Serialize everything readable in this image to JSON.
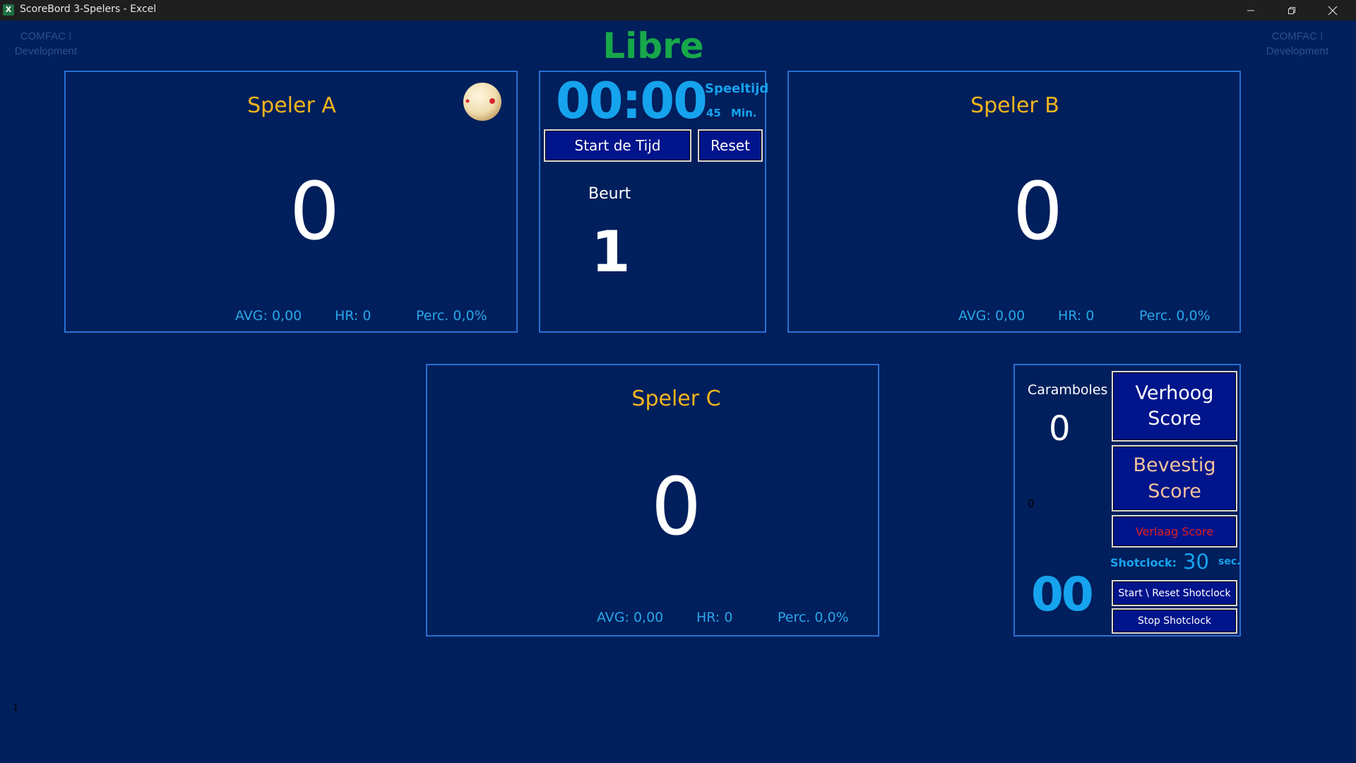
{
  "window": {
    "title": "ScoreBord 3-Spelers - Excel"
  },
  "watermark": {
    "left_line1": "COMFAC !",
    "left_line2": "Development",
    "right_line1": "COMFAC !",
    "right_line2": "Development"
  },
  "game_mode": "Libre",
  "players": {
    "a": {
      "name": "Speler A",
      "score": "0",
      "avg": "AVG: 0,00",
      "hr": "HR: 0",
      "perc": "Perc. 0,0%"
    },
    "b": {
      "name": "Speler B",
      "score": "0",
      "avg": "AVG: 0,00",
      "hr": "HR: 0",
      "perc": "Perc. 0,0%"
    },
    "c": {
      "name": "Speler C",
      "score": "0",
      "avg": "AVG: 0,00",
      "hr": "HR: 0",
      "perc": "Perc. 0,0%"
    }
  },
  "timer": {
    "time": "00:00",
    "label": "Speeltijd",
    "minutes": "45",
    "minutes_unit": "Min.",
    "start_label": "Start de Tijd",
    "reset_label": "Reset"
  },
  "turn": {
    "label": "Beurt",
    "value": "1"
  },
  "control": {
    "caramboles_label": "Caramboles",
    "caramboles_value": "0",
    "small_value": "0",
    "increase_label": "Verhoog Score",
    "confirm_label": "Bevestig Score",
    "decrease_label": "Verlaag Score",
    "shotclock_label": "Shotclock:",
    "shotclock_seconds": "30",
    "shotclock_unit": "sec.",
    "shotclock_display": "00",
    "start_reset_shotclock_label": "Start \\ Reset Shotclock",
    "stop_shotclock_label": "Stop Shotclock"
  },
  "cell_bottom_left": "1",
  "colors": {
    "background": "#001f5c",
    "panel_border": "#2a6fd1",
    "player_name": "#f2b51d",
    "accent_cyan": "#16a3ee",
    "mode_green": "#17a84a",
    "button_fill": "#00148c",
    "confirm_text": "#f4c49b",
    "decrease_text": "#e02020"
  },
  "icons": {
    "active_player": "billiard-ball-icon",
    "app": "excel-icon",
    "minimize": "minimize-icon",
    "restore": "restore-icon",
    "close": "close-icon"
  }
}
